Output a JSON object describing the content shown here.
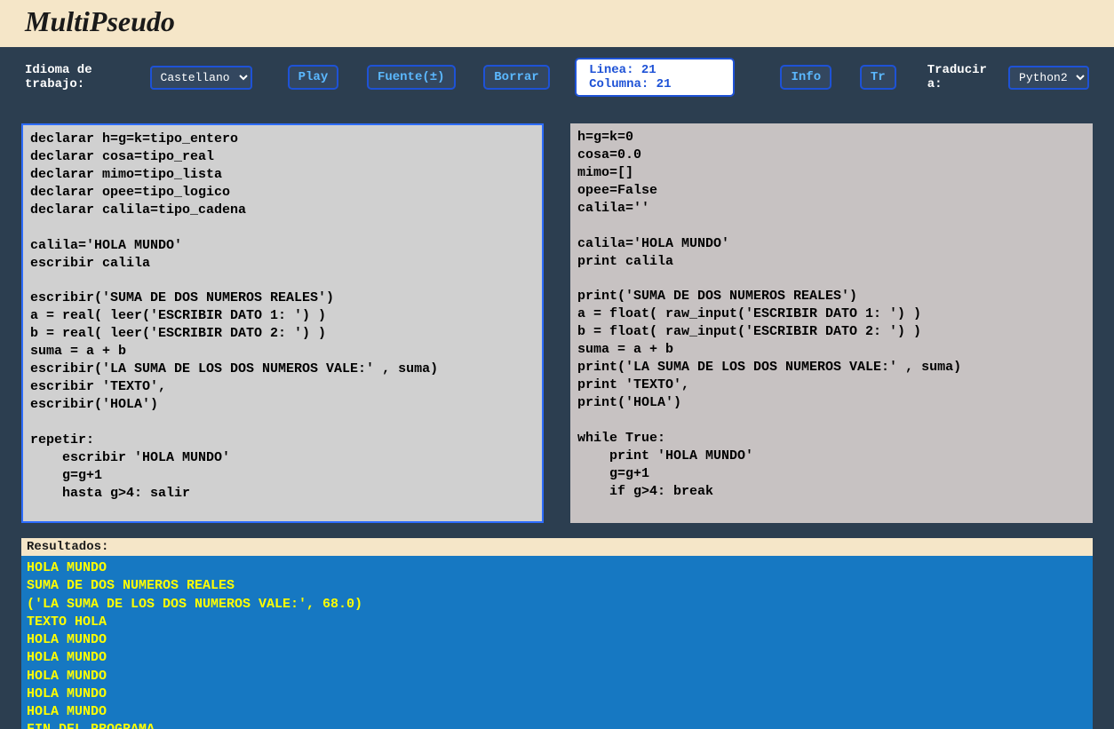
{
  "header": {
    "title": "MultiPseudo"
  },
  "toolbar": {
    "lang_label": "Idioma de trabajo:",
    "lang_select": {
      "value": "Castellano",
      "options": [
        "Castellano"
      ]
    },
    "play": "Play",
    "fuente": "Fuente(±)",
    "borrar": "Borrar",
    "status": "Linea: 21 Columna: 21",
    "info": "Info",
    "tr": "Tr",
    "translate_label": "Traducir a:",
    "translate_select": {
      "value": "Python2",
      "options": [
        "Python2"
      ]
    }
  },
  "editors": {
    "source": "declarar h=g=k=tipo_entero\ndeclarar cosa=tipo_real\ndeclarar mimo=tipo_lista\ndeclarar opee=tipo_logico\ndeclarar calila=tipo_cadena\n\ncalila='HOLA MUNDO'\nescribir calila\n\nescribir('SUMA DE DOS NUMEROS REALES')\na = real( leer('ESCRIBIR DATO 1: ') )\nb = real( leer('ESCRIBIR DATO 2: ') )\nsuma = a + b\nescribir('LA SUMA DE LOS DOS NUMEROS VALE:' , suma)\nescribir 'TEXTO',\nescribir('HOLA')\n\nrepetir:\n    escribir 'HOLA MUNDO'\n    g=g+1\n    hasta g>4: salir",
    "translated": "h=g=k=0\ncosa=0.0\nmimo=[]\nopee=False\ncalila=''\n\ncalila='HOLA MUNDO'\nprint calila\n\nprint('SUMA DE DOS NUMEROS REALES')\na = float( raw_input('ESCRIBIR DATO 1: ') )\nb = float( raw_input('ESCRIBIR DATO 2: ') )\nsuma = a + b\nprint('LA SUMA DE LOS DOS NUMEROS VALE:' , suma)\nprint 'TEXTO',\nprint('HOLA')\n\nwhile True:\n    print 'HOLA MUNDO'\n    g=g+1\n    if g>4: break"
  },
  "results": {
    "header": "Resultados:",
    "output": "HOLA MUNDO\nSUMA DE DOS NUMEROS REALES\n('LA SUMA DE LOS DOS NUMEROS VALE:', 68.0)\nTEXTO HOLA\nHOLA MUNDO\nHOLA MUNDO\nHOLA MUNDO\nHOLA MUNDO\nHOLA MUNDO\nFIN DEL PROGRAMA"
  }
}
